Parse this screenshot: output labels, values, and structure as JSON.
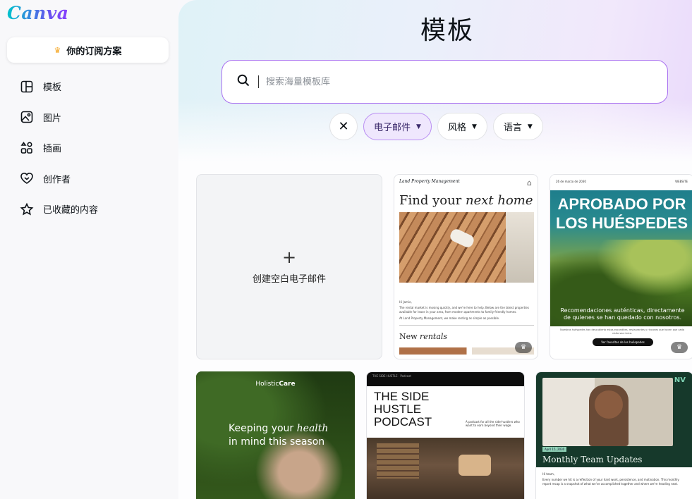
{
  "app": {
    "logo": "Canva"
  },
  "sidebar": {
    "plan_button": "你的订阅方案",
    "items": [
      {
        "label": "模板",
        "icon": "template-icon"
      },
      {
        "label": "图片",
        "icon": "image-icon"
      },
      {
        "label": "插画",
        "icon": "shapes-icon"
      },
      {
        "label": "创作者",
        "icon": "creator-heart-icon"
      },
      {
        "label": "已收藏的内容",
        "icon": "star-icon"
      }
    ]
  },
  "main": {
    "title": "模板",
    "search": {
      "placeholder": "搜索海量模板库",
      "value": ""
    },
    "filters": [
      {
        "label": "电子邮件",
        "active": true
      },
      {
        "label": "风格",
        "active": false
      },
      {
        "label": "语言",
        "active": false
      }
    ],
    "blank_card": {
      "label": "创建空白电子邮件"
    },
    "templates": [
      {
        "brand": "Land Property Management",
        "headline_plain": "Find your ",
        "headline_italic": "next home",
        "greeting": "Hi Jamie,",
        "body": "The rental market is moving quickly, and we're here to help. Below are the latest properties available for lease in your area, from modern apartments to family-friendly homes.",
        "body2": "At Land Property Management, we make renting as simple as possible.",
        "section_plain": "New ",
        "section_italic": "rentals",
        "premium": true
      },
      {
        "top_left": "26 de marzo de 2030",
        "top_right": "WEBSITE",
        "headline": "APROBADO POR LOS HUÉSPEDES",
        "subhead": "Recomendaciones auténticas, directamente de quienes se han quedado con nosotros.",
        "small": "Nuestros huéspedes han descubierto estos escondites, restaurantes y rincones que hacen que cada visita sea única.",
        "cta": "Ver favoritos de los huéspedes",
        "premium": true
      },
      {
        "brand_plain": "Holistic",
        "brand_bold": "Care",
        "line1_plain": "Keeping your ",
        "line1_italic": "health",
        "line2": "in mind this season"
      },
      {
        "topbar": "THE SIDE HUSTLE · Podcast",
        "title": "THE SIDE HUSTLE PODCAST",
        "blurb": "A podcast for all the side-hustlers who want to earn beyond their wage."
      },
      {
        "logo": "NV",
        "badge": "April 15, 2030",
        "headline": "Monthly Team Updates",
        "greeting": "Hi team,",
        "body": "Every number we hit is a reflection of your hard work, persistence, and motivation. This monthly report recap is a snapshot of what we've accomplished together and where we're heading next."
      }
    ]
  },
  "colors": {
    "accent": "#8b3dff",
    "search_border": "#a970f0",
    "active_chip": "#efe7fd"
  }
}
